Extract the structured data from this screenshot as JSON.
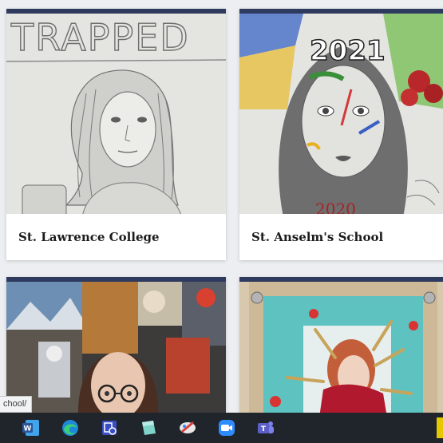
{
  "cards": [
    {
      "caption": "St. Lawrence College",
      "artwork_text": "TRAPPED"
    },
    {
      "caption": "St. Anselm's School",
      "artwork_text_top": "2021",
      "artwork_text_bottom": "2020"
    },
    {
      "caption": ""
    },
    {
      "caption": ""
    }
  ],
  "status_bar": {
    "url": "chool/"
  },
  "taskbar": {
    "apps": [
      {
        "name": "Microsoft Word",
        "icon": "word-icon",
        "color": "#2b579a"
      },
      {
        "name": "Microsoft Edge",
        "icon": "edge-icon",
        "color": "#1e88d9"
      },
      {
        "name": "Remote Desktop",
        "icon": "remote-desktop-icon",
        "color": "#3a4ec4"
      },
      {
        "name": "Sticky Notes",
        "icon": "notes-icon",
        "color": "#7fd3c8"
      },
      {
        "name": "Snip & Sketch",
        "icon": "snip-sketch-icon",
        "color": "#d94040"
      },
      {
        "name": "Zoom",
        "icon": "zoom-icon",
        "color": "#2d8cff"
      },
      {
        "name": "Microsoft Teams",
        "icon": "teams-icon",
        "color": "#5b5fc7"
      }
    ]
  },
  "colors": {
    "card_top_bar": "#2f3b5e",
    "page_background": "#eceef1",
    "taskbar": "#20252c"
  }
}
